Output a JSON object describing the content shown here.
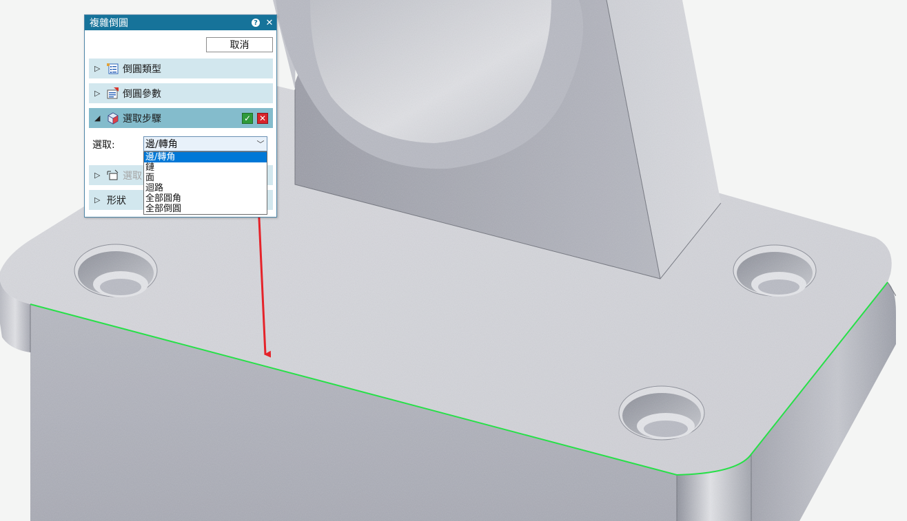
{
  "dialog": {
    "title": "複雜倒圓",
    "help_icon": "?",
    "close_icon": "✕",
    "cancel_label": "取消"
  },
  "sections": {
    "fillet_type": {
      "label": "倒圓類型",
      "expanded": false
    },
    "fillet_params": {
      "label": "倒圓參數",
      "expanded": false
    },
    "selection_step": {
      "label": "選取步驟",
      "expanded": true
    },
    "select_other": {
      "label": "選取",
      "expanded": false,
      "disabled": true
    },
    "shape": {
      "label": "形狀",
      "expanded": false
    }
  },
  "selection": {
    "label": "選取:",
    "selected": "邊/轉角",
    "options": [
      "邊/轉角",
      "鏈",
      "面",
      "迴路",
      "全部圓角",
      "全部倒圓"
    ]
  },
  "colors": {
    "title_bar": "#16739a",
    "section_bg": "#d2e7ee",
    "section_active_bg": "#84bccc",
    "highlight_edge": "#27e048",
    "arrow": "#e5232a",
    "dropdown_selected": "#0078d7"
  },
  "icons": {
    "ok": "check-icon",
    "cancel": "x-icon",
    "collapsed": "triangle-right-icon",
    "expanded": "triangle-down-icon"
  }
}
